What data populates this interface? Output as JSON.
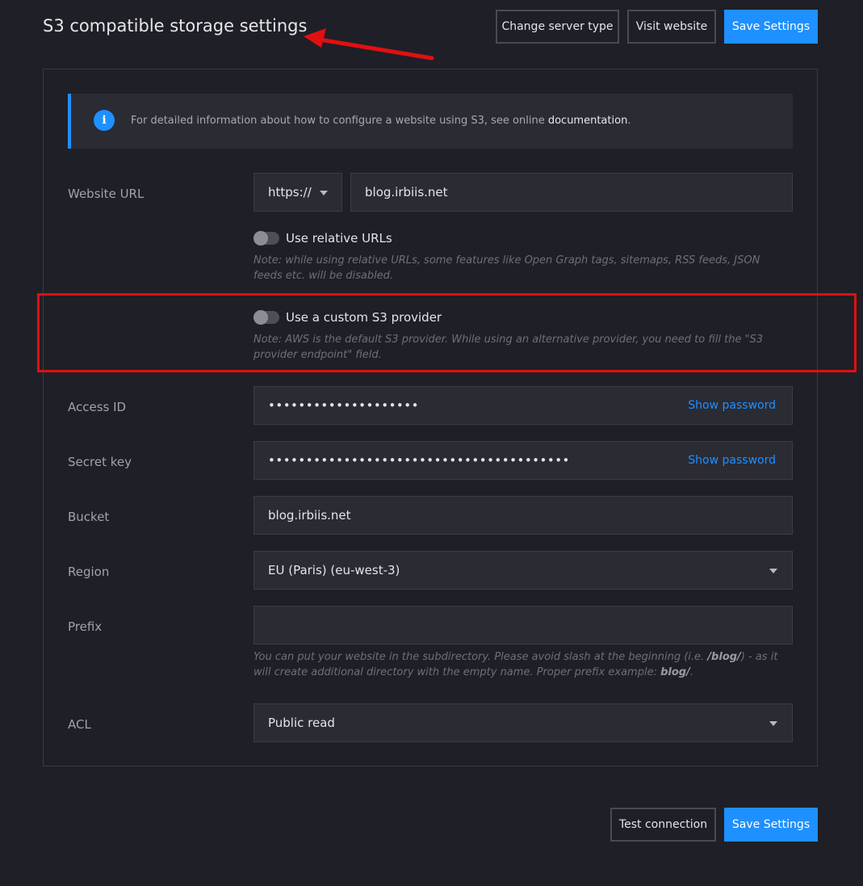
{
  "header": {
    "title": "S3 compatible storage settings",
    "change_server_type": "Change server type",
    "visit_website": "Visit website",
    "save_settings": "Save Settings"
  },
  "info": {
    "text": "For detailed information about how to configure a website using S3, see online ",
    "link": "documentation",
    "suffix": ".",
    "icon": "info-icon"
  },
  "website_url": {
    "label": "Website URL",
    "protocol": "https://",
    "value": "blog.irbiis.net"
  },
  "relative_urls": {
    "label": "Use relative URLs",
    "enabled": false,
    "note": "Note: while using relative URLs, some features like Open Graph tags, sitemaps, RSS feeds, JSON feeds etc. will be disabled."
  },
  "custom_provider": {
    "label": "Use a custom S3 provider",
    "enabled": false,
    "note": "Note: AWS is the default S3 provider. While using an alternative provider, you need to fill the \"S3 provider endpoint\" field."
  },
  "access_id": {
    "label": "Access ID",
    "value": "••••••••••••••••••••",
    "show": "Show password"
  },
  "secret_key": {
    "label": "Secret key",
    "value": "••••••••••••••••••••••••••••••••••••••••",
    "show": "Show password"
  },
  "bucket": {
    "label": "Bucket",
    "value": "blog.irbiis.net"
  },
  "region": {
    "label": "Region",
    "value": "EU (Paris) (eu-west-3)"
  },
  "prefix": {
    "label": "Prefix",
    "value": "",
    "note_a": "You can put your website in the subdirectory. Please avoid slash at the beginning (i.e. ",
    "note_b": "/blog/",
    "note_c": ") - as it will create additional directory with the empty name. Proper prefix example: ",
    "note_d": "blog/",
    "note_e": "."
  },
  "acl": {
    "label": "ACL",
    "value": "Public read"
  },
  "footer": {
    "test_connection": "Test connection",
    "save_settings": "Save Settings"
  },
  "colors": {
    "background": "#1f1f27",
    "accent": "#1e90ff",
    "annotation": "#e01010"
  }
}
